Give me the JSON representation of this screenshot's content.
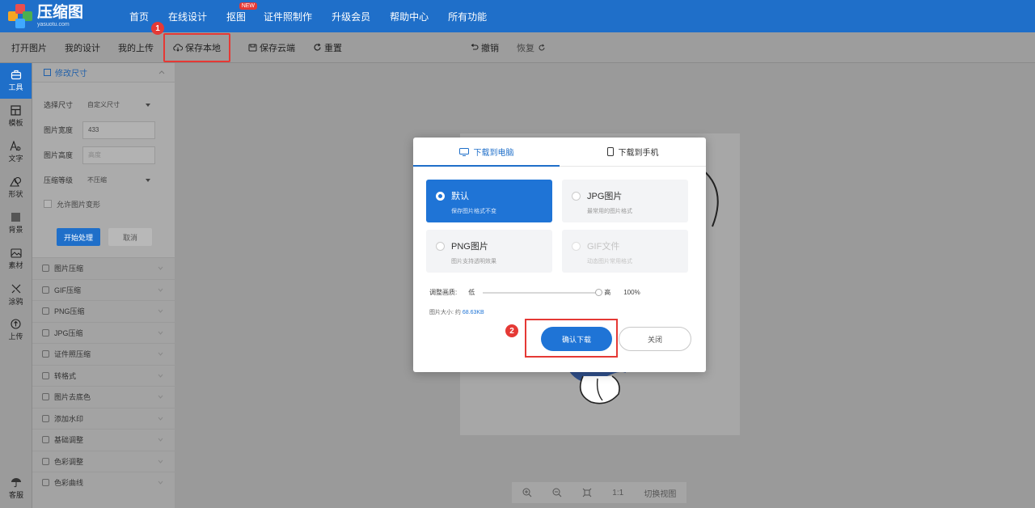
{
  "app": {
    "logo_title": "压缩图",
    "logo_subtitle": "yasuotu.com"
  },
  "nav": {
    "items": [
      "首页",
      "在线设计",
      "抠图",
      "证件照制作",
      "升级会员",
      "帮助中心",
      "所有功能"
    ],
    "badge": "NEW"
  },
  "toolbar": {
    "open": "打开图片",
    "my_design": "我的设计",
    "my_upload": "我的上传",
    "save_local": "保存本地",
    "save_cloud": "保存云端",
    "reset": "重置",
    "undo": "撤销",
    "redo": "恢复",
    "marker_1": "1"
  },
  "rail": {
    "items": [
      "工具",
      "模板",
      "文字",
      "形状",
      "背景",
      "素材",
      "涂鸦",
      "上传"
    ],
    "bottom": "客服"
  },
  "panel": {
    "head": "修改尺寸",
    "rows": [
      {
        "label": "选择尺寸",
        "value": "自定义尺寸"
      },
      {
        "label": "图片宽度",
        "value": "433"
      },
      {
        "label": "图片高度",
        "value": "高度"
      },
      {
        "label": "压缩等级",
        "value": "不压缩"
      }
    ],
    "checkbox": "允许图片变形",
    "start_btn": "开始处理",
    "cancel_btn": "取消",
    "menu": [
      "图片压缩",
      "GIF压缩",
      "PNG压缩",
      "JPG压缩",
      "证件照压缩",
      "转格式",
      "图片去底色",
      "添加水印",
      "基础调整",
      "色彩调整",
      "色彩曲线"
    ]
  },
  "canvas_bar": {
    "one_to_one": "1:1",
    "switch_view": "切换视图"
  },
  "modal": {
    "tab_pc": "下载到电脑",
    "tab_mobile": "下载到手机",
    "options": [
      {
        "title": "默认",
        "sub": "保存图片格式不变"
      },
      {
        "title": "JPG图片",
        "sub": "最常用的图片格式"
      },
      {
        "title": "PNG图片",
        "sub": "图片支持透明效果"
      },
      {
        "title": "GIF文件",
        "sub": "动态图片常用格式"
      }
    ],
    "quality_label": "调整画质:",
    "quality_low": "低",
    "quality_high": "高",
    "quality_value": "100%",
    "quality_level": 1.0,
    "size_prefix": "图片大小: 约",
    "size_value": "68.63KB",
    "confirm": "确认下载",
    "close": "关闭",
    "marker_2": "2"
  }
}
